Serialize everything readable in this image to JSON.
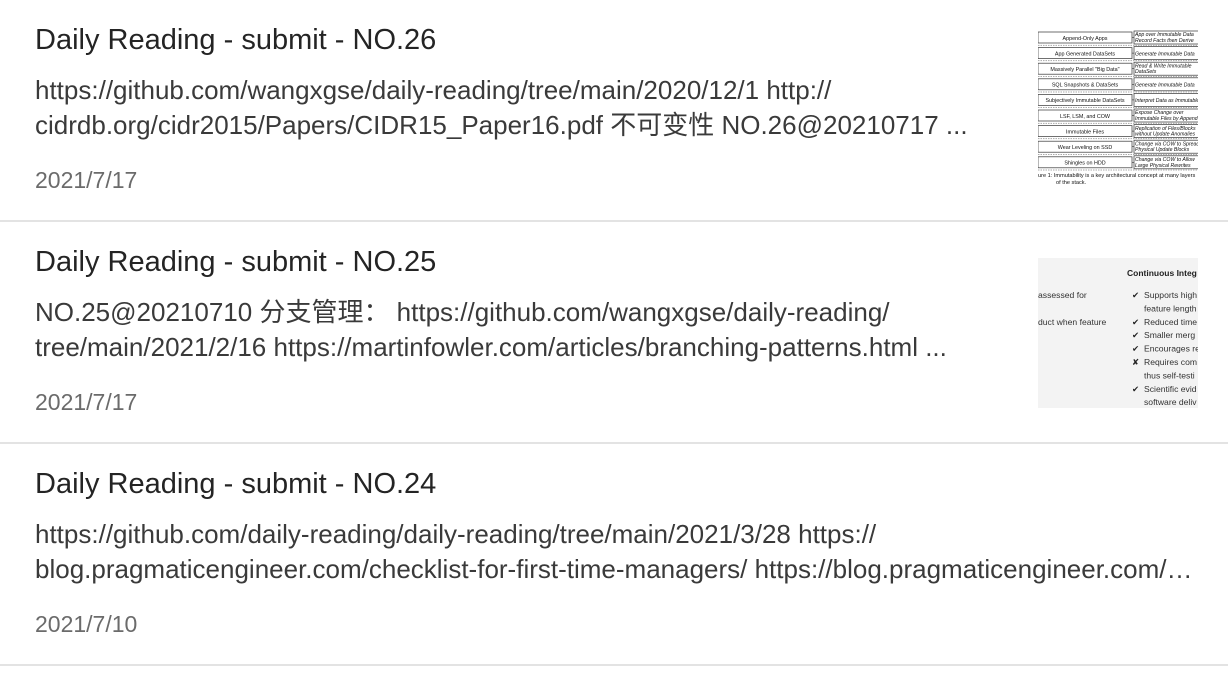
{
  "posts": [
    {
      "title": "Daily Reading - submit - NO.26",
      "excerpt_line1": "https://github.com/wangxgse/daily-reading/tree/main/2020/12/1 http://",
      "excerpt_line2": "cidrdb.org/cidr2015/Papers/CIDR15_Paper16.pdf 不可变性 NO.26@20210717 ...",
      "date": "2021/7/17",
      "thumbnail": {
        "rows": [
          {
            "left": "Append-Only Apps",
            "right1": "App over Immutable Data",
            "right2": "Record Facts then Derive"
          },
          {
            "left": "App Generated DataSets",
            "right1": "Generate Immutable Data",
            "right2": ""
          },
          {
            "left": "Massively Parallel \"Big Data\"",
            "right1": "Read & Write Immutable",
            "right2": "DataSets"
          },
          {
            "left": "SQL Snapshots & DataSets",
            "right1": "Generate Immutable Data",
            "right2": ""
          },
          {
            "left": "Subjectively Immutable DataSets",
            "right1": "Interpret Data as Immutable",
            "right2": ""
          },
          {
            "left": "LSF, LSM, and COW",
            "right1": "Expose Change over",
            "right2": "Immutable Files by Append"
          },
          {
            "left": "Immutable Files",
            "right1": "Replication of Files/Blocks",
            "right2": "without Update Anomalies"
          },
          {
            "left": "Wear Leveling on SSD",
            "right1": "Change via COW to Spread",
            "right2": "Physical Update Blocks"
          },
          {
            "left": "Shingles on HDD",
            "right1": "Change via COW to Allow",
            "right2": "Large Physical Rewrites"
          }
        ],
        "caption1": "ure 1:  Immutability is a key architectural concept at many layers",
        "caption2": "of the stack."
      }
    },
    {
      "title": "Daily Reading - submit - NO.25",
      "excerpt_line1": "NO.25@20210710 分支管理：  https://github.com/wangxgse/daily-reading/",
      "excerpt_line2": "tree/main/2021/2/16 https://martinfowler.com/articles/branching-patterns.html ...",
      "date": "2021/7/17",
      "thumbnail": {
        "heading": "Continuous Integ",
        "left_lines": [
          "assessed for",
          "duct when feature"
        ],
        "items": [
          {
            "mark": "✔",
            "text": "Supports high"
          },
          {
            "mark": "",
            "text": "feature length"
          },
          {
            "mark": "✔",
            "text": "Reduced time"
          },
          {
            "mark": "✔",
            "text": "Smaller merg"
          },
          {
            "mark": "✔",
            "text": "Encourages re"
          },
          {
            "mark": "✘",
            "text": "Requires com"
          },
          {
            "mark": "",
            "text": "thus self-testi"
          },
          {
            "mark": "✔",
            "text": "Scientific evid"
          },
          {
            "mark": "",
            "text": "software deliv"
          }
        ]
      }
    },
    {
      "title": "Daily Reading - submit - NO.24",
      "excerpt_line1": "https://github.com/daily-reading/daily-reading/tree/main/2021/3/28 https://",
      "excerpt_line2": "blog.pragmaticengineer.com/checklist-for-first-time-managers/ https://blog.pragmaticengineer.com/ ...",
      "date": "2021/7/10"
    }
  ]
}
